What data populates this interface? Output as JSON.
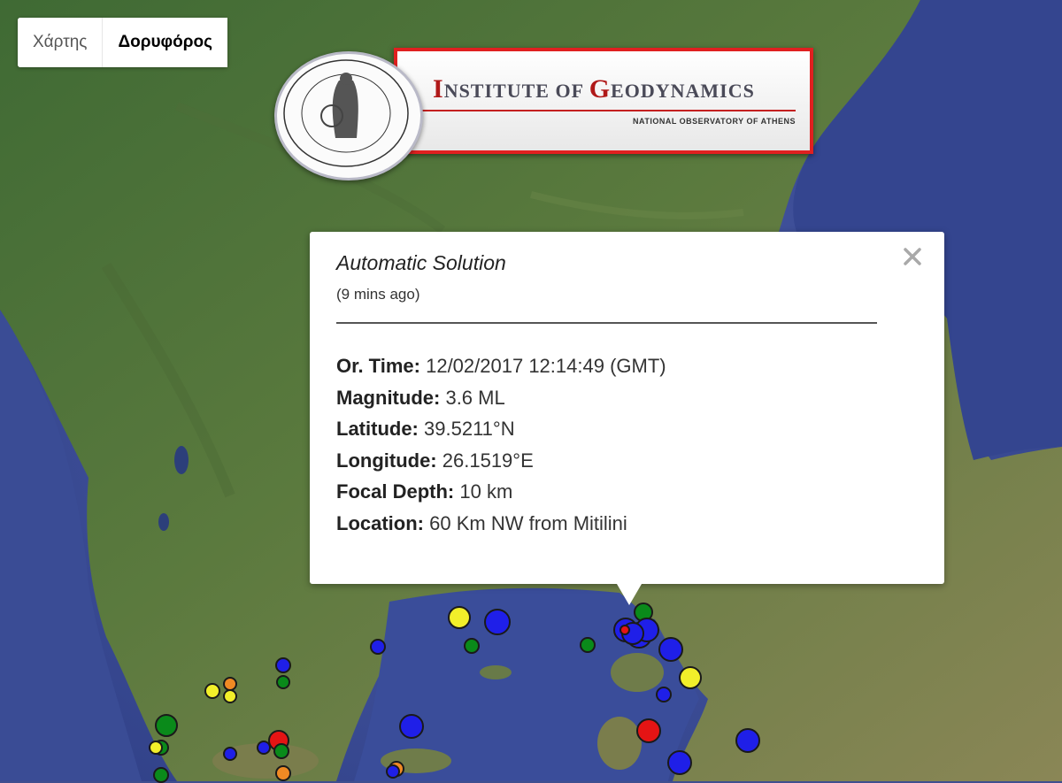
{
  "map_type_control": {
    "map_label": "Χάρτης",
    "satellite_label": "Δορυφόρος",
    "active": "satellite"
  },
  "logo": {
    "title_caps": [
      "I",
      "G"
    ],
    "title_parts": [
      "NSTITUTE OF ",
      "EODYNAMICS"
    ],
    "subtitle": "NATIONAL OBSERVATORY OF ATHENS",
    "seal_text": "NATIONAL OBSERVATORY ATHENS"
  },
  "info_window": {
    "title": "Automatic Solution",
    "age": "(9 mins ago)",
    "close_icon": "close-icon",
    "rows": [
      {
        "label": "Or. Time:",
        "value": "12/02/2017  12:14:49 (GMT)"
      },
      {
        "label": "Magnitude:",
        "value": "3.6 ML"
      },
      {
        "label": "Latitude:",
        "value": "39.5211°N"
      },
      {
        "label": "Longitude:",
        "value": "26.1519°E"
      },
      {
        "label": "Focal Depth:",
        "value": "10 km"
      },
      {
        "label": "Location:",
        "value": "60 Km NW from Mitilini"
      }
    ]
  },
  "colors": {
    "blue": "#1f1fe8",
    "green": "#0a8a1a",
    "yellow": "#f2ef2a",
    "red": "#e51414",
    "orange": "#f08a24"
  }
}
